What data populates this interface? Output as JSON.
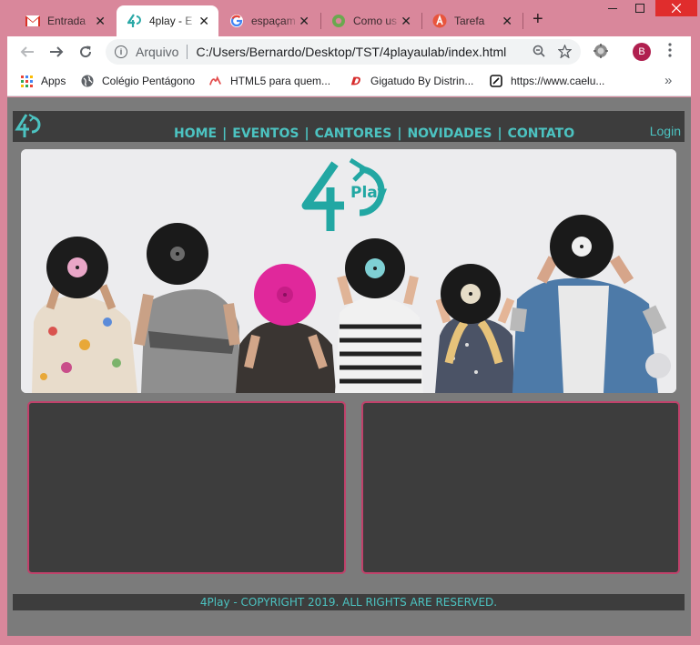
{
  "browser": {
    "tabs": [
      {
        "title": "Entrada",
        "icon": "gmail-icon",
        "active": false
      },
      {
        "title": "4play - E",
        "icon": "4play-favicon",
        "active": true
      },
      {
        "title": "espaçam",
        "icon": "google-icon",
        "active": false
      },
      {
        "title": "Como us",
        "icon": "green-circle-icon",
        "active": false
      },
      {
        "title": "Tarefa",
        "icon": "tarefa-icon",
        "active": false
      }
    ],
    "close_glyph": "✕",
    "new_tab_glyph": "+",
    "omnibox": {
      "scheme": "Arquivo",
      "url": "C:/Users/Bernardo/Desktop/TST/4playaulab/index.html"
    },
    "avatar_letter": "B",
    "bookmarks": [
      {
        "label": "Apps",
        "icon": "apps-grid-icon"
      },
      {
        "label": "Colégio Pentágono",
        "icon": "globe-icon"
      },
      {
        "label": "HTML5 para quem...",
        "icon": "html5-icon"
      },
      {
        "label": "Gigatudo By Distrin...",
        "icon": "gigatudo-icon"
      },
      {
        "label": "https://www.caelu...",
        "icon": "caelum-icon"
      }
    ],
    "overflow_glyph": "»"
  },
  "site": {
    "logo_text": "4P",
    "nav": [
      "HOME",
      "EVENTOS",
      "CANTORES",
      "NOVIDADES",
      "CONTATO"
    ],
    "nav_separator": "|",
    "login": "Login",
    "banner_logo_text": "Play",
    "footer": "4Play - COPYRIGHT 2019. ALL RIGHTS ARE RESERVED."
  },
  "colors": {
    "accent": "#4cc3c1",
    "frame": "#d9879b",
    "box_border": "#c0426b",
    "panel": "#3d3d3d",
    "page_bg": "#7b7b7b"
  }
}
